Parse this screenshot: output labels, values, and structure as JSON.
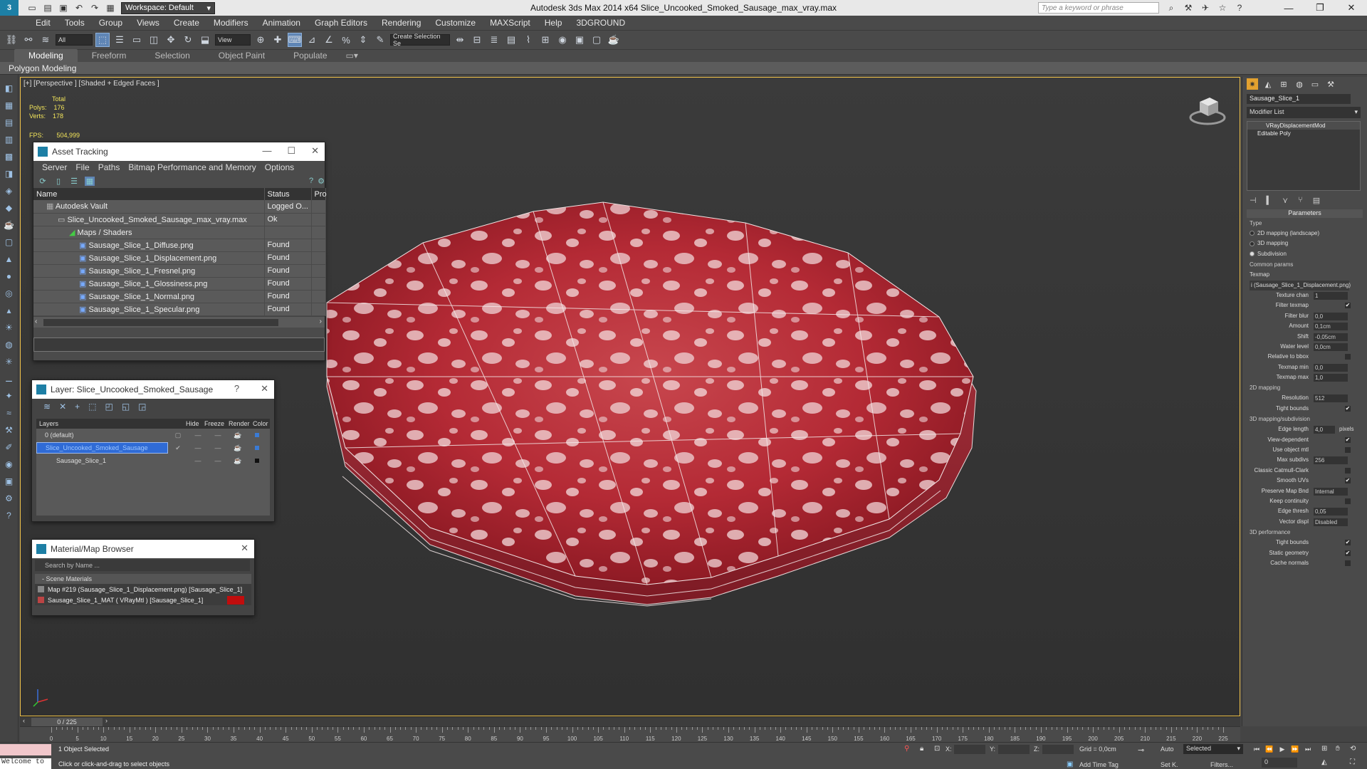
{
  "titlebar": {
    "logo": "3",
    "workspace": "Workspace: Default",
    "app_title": "Autodesk 3ds Max  2014 x64      Slice_Uncooked_Smoked_Sausage_max_vray.max",
    "search_placeholder": "Type a keyword or phrase"
  },
  "menu": [
    "Edit",
    "Tools",
    "Group",
    "Views",
    "Create",
    "Modifiers",
    "Animation",
    "Graph Editors",
    "Rendering",
    "Customize",
    "MAXScript",
    "Help",
    "3DGROUND"
  ],
  "toolbar": {
    "filter_select": "All",
    "ref_coord": "View",
    "named_selection": "Create Selection Se"
  },
  "ribbon": {
    "tabs": [
      "Modeling",
      "Freeform",
      "Selection",
      "Object Paint",
      "Populate"
    ],
    "active": "Modeling",
    "sub": "Polygon Modeling"
  },
  "viewport": {
    "label": "[+] [Perspective ] [Shaded + Edged Faces ]",
    "stats_total": "Total",
    "polys_label": "Polys:",
    "polys": "176",
    "verts_label": "Verts:",
    "verts": "178",
    "fps_label": "FPS:",
    "fps": "504,999"
  },
  "asset_tracking": {
    "title": "Asset Tracking",
    "menu": [
      "Server",
      "File",
      "Paths",
      "Bitmap Performance and Memory",
      "Options"
    ],
    "columns": [
      "Name",
      "Status",
      "Pro"
    ],
    "rows": [
      {
        "name": "Autodesk Vault",
        "status": "Logged O...",
        "indent": 0
      },
      {
        "name": "Slice_Uncooked_Smoked_Sausage_max_vray.max",
        "status": "Ok",
        "indent": 1
      },
      {
        "name": "Maps / Shaders",
        "status": "",
        "indent": 2
      },
      {
        "name": "Sausage_Slice_1_Diffuse.png",
        "status": "Found",
        "indent": 3
      },
      {
        "name": "Sausage_Slice_1_Displacement.png",
        "status": "Found",
        "indent": 3
      },
      {
        "name": "Sausage_Slice_1_Fresnel.png",
        "status": "Found",
        "indent": 3
      },
      {
        "name": "Sausage_Slice_1_Glossiness.png",
        "status": "Found",
        "indent": 3
      },
      {
        "name": "Sausage_Slice_1_Normal.png",
        "status": "Found",
        "indent": 3
      },
      {
        "name": "Sausage_Slice_1_Specular.png",
        "status": "Found",
        "indent": 3
      }
    ]
  },
  "layer_window": {
    "title": "Layer: Slice_Uncooked_Smoked_Sausage",
    "help": "?",
    "columns": [
      "Layers",
      "Hide",
      "Freeze",
      "Render",
      "Color"
    ],
    "rows": [
      {
        "name": "0 (default)",
        "selected": false,
        "color": "#3a7bd5"
      },
      {
        "name": "Slice_Uncooked_Smoked_Sausage",
        "selected": true,
        "color": "#3a7bd5"
      },
      {
        "name": "Sausage_Slice_1",
        "selected": false,
        "color": "#111111"
      }
    ]
  },
  "material_browser": {
    "title": "Material/Map Browser",
    "search_placeholder": "Search by Name ...",
    "group": "- Scene Materials",
    "items": [
      "Map #219 (Sausage_Slice_1_Displacement.png) [Sausage_Slice_1]",
      "Sausage_Slice_1_MAT ( VRayMtl ) [Sausage_Slice_1]"
    ]
  },
  "command_panel": {
    "object_name": "Sausage_Slice_1",
    "modifier_list": "Modifier List",
    "stack": [
      "VRayDisplacementMod",
      "Editable Poly"
    ],
    "section": "Parameters",
    "type_label": "Type",
    "type_options": [
      "2D mapping (landscape)",
      "3D mapping",
      "Subdivision"
    ],
    "common_label": "Common params",
    "texmap_label": "Texmap",
    "texmap_value": "i (Sausage_Slice_1_Displacement.png)",
    "texture_chan_label": "Texture chan",
    "texture_chan": "1",
    "filter_texmap_label": "Filter texmap",
    "filter_blur_label": "Filter blur",
    "filter_blur": "0,0",
    "amount_label": "Amount",
    "amount": "0,1cm",
    "shift_label": "Shift",
    "shift": "-0,05cm",
    "water_label": "Water level",
    "water": "0,0cm",
    "relbbox_label": "Relative to bbox",
    "texmin_label": "Texmap min",
    "texmin": "0,0",
    "texmax_label": "Texmap max",
    "texmax": "1,0",
    "map2d_label": "2D mapping",
    "resolution_label": "Resolution",
    "resolution": "512",
    "tight1_label": "Tight bounds",
    "map3d_label": "3D mapping/subdivision",
    "edge_label": "Edge length",
    "edge": "4,0",
    "pixels": "pixels",
    "viewdep_label": "View-dependent",
    "objmtl_label": "Use object mtl",
    "maxsub_label": "Max subdivs",
    "maxsub": "256",
    "catmull_label": "Classic Catmull-Clark",
    "smooth_label": "Smooth UVs",
    "preserve_label": "Preserve Map Bnd",
    "preserve": "Internal",
    "keepcont_label": "Keep continuity",
    "edgethresh_label": "Edge thresh",
    "edgethresh": "0,05",
    "vectordisp_label": "Vector displ",
    "vectordisp": "Disabled",
    "perf_label": "3D performance",
    "tight2_label": "Tight bounds",
    "staticgeo_label": "Static geometry",
    "cache_label": "Cache normals",
    "check": "✔"
  },
  "timeline": {
    "slider": "0 / 225",
    "ticks": [
      "0",
      "5",
      "10",
      "15",
      "20",
      "25",
      "30",
      "35",
      "40",
      "45",
      "50",
      "55",
      "60",
      "65",
      "70",
      "75",
      "80",
      "85",
      "90",
      "95",
      "100",
      "105",
      "110",
      "115",
      "120",
      "125",
      "130",
      "135",
      "140",
      "145",
      "150",
      "155",
      "160",
      "165",
      "170",
      "175",
      "180",
      "185",
      "190",
      "195",
      "200",
      "205",
      "210",
      "215",
      "220",
      "225"
    ]
  },
  "status": {
    "welcome": "Welcome to",
    "selected": "1 Object Selected",
    "hint": "Click or click-and-drag to select objects",
    "x_label": "X:",
    "y_label": "Y:",
    "z_label": "Z:",
    "grid": "Grid = 0,0cm",
    "add_time_tag": "Add Time Tag",
    "auto": "Auto",
    "set_key": "Set K.",
    "selection": "Selected",
    "filters": "Filters...",
    "frame": "0"
  },
  "colors": {
    "accent": "#5f85b5",
    "viewport_border": "#f0c24a",
    "selection": "#2f6bd6",
    "material_swatch": "#c10d0d"
  }
}
